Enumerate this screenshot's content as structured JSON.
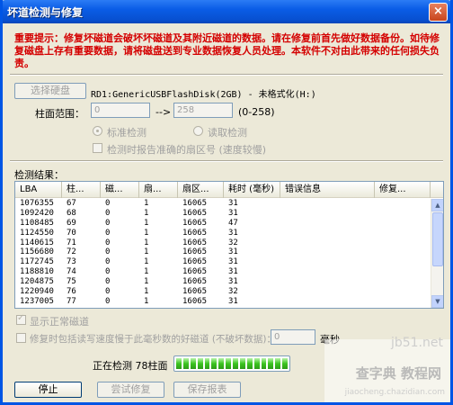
{
  "window": {
    "title": "坏道检测与修复",
    "close_glyph": "×"
  },
  "warning": {
    "text": "重要提示：修复坏磁道会破坏坏磁道及其附近磁道的数据。请在修复前首先做好数据备份。如待修复磁盘上存有重要数据，请将磁盘送到专业数据恢复人员处理。本软件不对由此带来的任何损失负责。"
  },
  "device": {
    "select_button": "选择硬盘",
    "name": "RD1:GenericUSBFlashDisk(2GB) - 未格式化(H:)"
  },
  "range": {
    "label": "柱面范围：",
    "from": "0",
    "arrow": "-->",
    "to": "258",
    "hint": "(0-258)"
  },
  "mode": {
    "standard": "标准检测",
    "read": "读取检测",
    "selected": "standard",
    "report_accurate": "检测时报告准确的扇区号 (速度较慢)",
    "report_accurate_checked": false
  },
  "results": {
    "label": "检测结果：",
    "columns": [
      "LBA",
      "柱...",
      "磁...",
      "扇...",
      "扇区...",
      "耗时 (毫秒)",
      "错误信息",
      "修复..."
    ],
    "rows": [
      [
        "1076355",
        "67",
        "0",
        "1",
        "16065",
        "31"
      ],
      [
        "1092420",
        "68",
        "0",
        "1",
        "16065",
        "31"
      ],
      [
        "1108485",
        "69",
        "0",
        "1",
        "16065",
        "47"
      ],
      [
        "1124550",
        "70",
        "0",
        "1",
        "16065",
        "31"
      ],
      [
        "1140615",
        "71",
        "0",
        "1",
        "16065",
        "32"
      ],
      [
        "1156680",
        "72",
        "0",
        "1",
        "16065",
        "31"
      ],
      [
        "1172745",
        "73",
        "0",
        "1",
        "16065",
        "31"
      ],
      [
        "1188810",
        "74",
        "0",
        "1",
        "16065",
        "31"
      ],
      [
        "1204875",
        "75",
        "0",
        "1",
        "16065",
        "31"
      ],
      [
        "1220940",
        "76",
        "0",
        "1",
        "16065",
        "32"
      ],
      [
        "1237005",
        "77",
        "0",
        "1",
        "16065",
        "31"
      ]
    ]
  },
  "options": {
    "show_normal": "显示正常磁道",
    "show_normal_checked": true,
    "repair_slow": "修复时包括读写速度慢于此毫秒数的好磁道 (不破坏数据)：",
    "repair_slow_checked": false,
    "ms_value": "0",
    "ms_unit": "毫秒"
  },
  "progress": {
    "label": "正在检测 78柱面",
    "segments": 16
  },
  "buttons": {
    "stop": "停止",
    "try_repair": "尝试修复",
    "save_report": "保存报表"
  },
  "watermark": {
    "line1": "jb51.net",
    "line2": "查字典 教程网",
    "line3": "jiaocheng.chazidian.com"
  },
  "colors": {
    "warning": "#d40000",
    "title_bar": "#0a5ce6",
    "progress": "#3bc41f"
  }
}
